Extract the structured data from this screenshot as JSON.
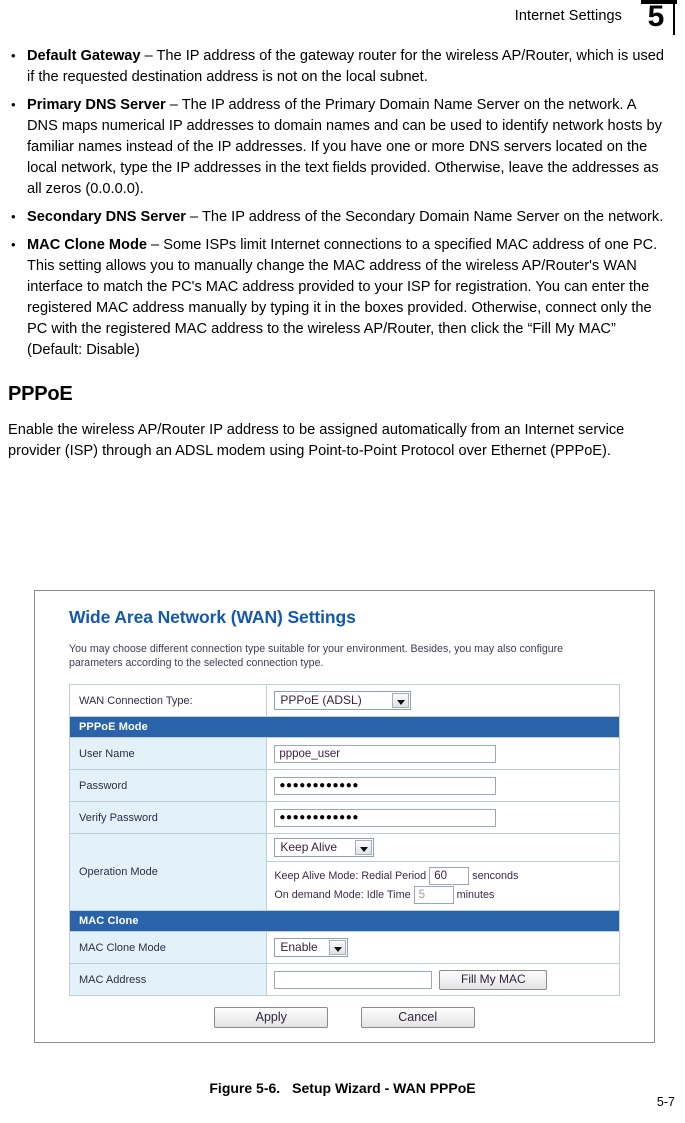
{
  "header": {
    "title": "Internet Settings",
    "chapter": "5"
  },
  "bullets": [
    {
      "term": "Default Gateway",
      "text": " – The IP address of the gateway router for the wireless AP/Router, which is used if the requested destination address is not on the local subnet."
    },
    {
      "term": "Primary DNS Server",
      "text": " – The IP address of the Primary Domain Name Server on the network. A DNS maps numerical IP addresses to domain names and can be used to identify network hosts by familiar names instead of the IP addresses. If you have one or more DNS servers located on the local network, type the IP addresses in the text fields provided. Otherwise, leave the addresses as all zeros (0.0.0.0)."
    },
    {
      "term": "Secondary DNS Server",
      "text": " – The IP address of the Secondary Domain Name Server on the network."
    },
    {
      "term": "MAC Clone Mode",
      "text": " – Some ISPs limit Internet connections to a specified MAC address of one PC. This setting allows you to manually change the MAC address of the wireless AP/Router's WAN interface to match the PC's MAC address provided to your ISP for registration. You can enter the registered MAC address manually by typing it in the boxes provided. Otherwise, connect only the PC with the registered MAC address to the wireless AP/Router, then click the “Fill My MAC” (Default: Disable)"
    }
  ],
  "section": {
    "heading": "PPPoE",
    "paragraph": "Enable the wireless AP/Router IP address to be assigned automatically from an Internet service provider (ISP) through an ADSL modem using Point-to-Point Protocol over Ethernet (PPPoE)."
  },
  "screenshot": {
    "title": "Wide Area Network (WAN) Settings",
    "description": "You may choose different connection type suitable for your environment. Besides, you may also configure parameters according to the selected connection type.",
    "title_color": "#1359b0",
    "section_header_color": "#2b63ab",
    "label_cell_color": "#e3f1f8",
    "wan_connection_type": {
      "label": "WAN Connection Type:",
      "value": "PPPoE (ADSL)"
    },
    "pppoe_section": {
      "header": "PPPoE Mode",
      "rows": [
        {
          "label": "User Name",
          "value": "pppoe_user"
        },
        {
          "label": "Password",
          "value": "●●●●●●●●●●●●"
        },
        {
          "label": "Verify Password",
          "value": "●●●●●●●●●●●●"
        }
      ],
      "operation_mode": {
        "label": "Operation Mode",
        "select_value": "Keep Alive",
        "keep_alive_prefix": "Keep Alive Mode: Redial Period",
        "keep_alive_value": "60",
        "keep_alive_suffix": "senconds",
        "on_demand_prefix": "On demand Mode: Idle Time",
        "on_demand_value": "5",
        "on_demand_suffix": "minutes"
      }
    },
    "mac_clone_section": {
      "header": "MAC Clone",
      "mode_label": "MAC Clone Mode",
      "mode_value": "Enable",
      "address_label": "MAC Address",
      "address_value": "",
      "fill_button": "Fill My MAC"
    },
    "buttons": {
      "apply": "Apply",
      "cancel": "Cancel"
    }
  },
  "figure": {
    "number": "Figure 5-6.",
    "caption": "Setup Wizard - WAN PPPoE"
  },
  "footer": {
    "page_number": "5-7"
  }
}
